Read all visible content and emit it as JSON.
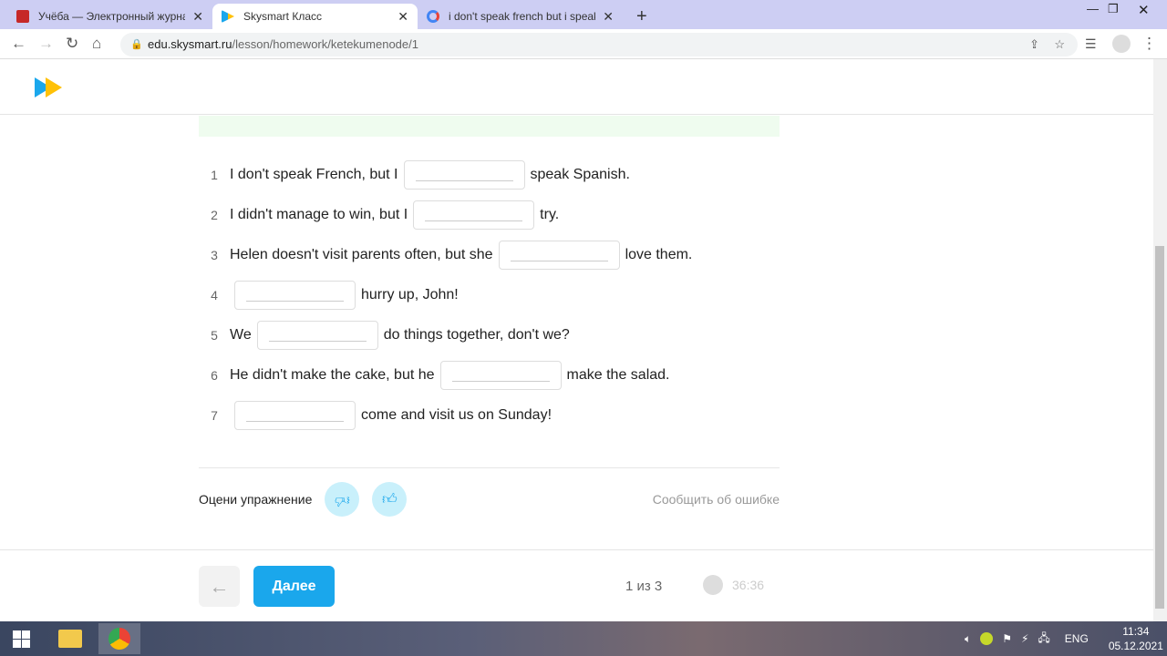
{
  "browser": {
    "tabs": [
      {
        "label": "Учёба — Электронный журнал",
        "favicon": "diary-icon",
        "color": "#c62828"
      },
      {
        "label": "Skysmart Класс",
        "favicon": "skysmart-icon",
        "active": true
      },
      {
        "label": "i don't speak french but i speak s",
        "favicon": "google-icon"
      }
    ],
    "new_tab": "+",
    "url_host": "edu.skysmart.ru",
    "url_path": "/lesson/homework/ketekumenode/1"
  },
  "exercise": {
    "rows": [
      {
        "n": "1",
        "before": "I don't speak French, but I",
        "after": "speak Spanish."
      },
      {
        "n": "2",
        "before": "I didn't manage to win, but I",
        "after": "try."
      },
      {
        "n": "3",
        "before": "Helen doesn't visit parents often, but she",
        "after": "love them."
      },
      {
        "n": "4",
        "before": "",
        "after": "hurry up, John!"
      },
      {
        "n": "5",
        "before": "We",
        "after": "do things together, don't we?"
      },
      {
        "n": "6",
        "before": "He didn't make the cake, but he",
        "after": "make the salad."
      },
      {
        "n": "7",
        "before": "",
        "after": "come and visit us on Sunday!"
      }
    ]
  },
  "rating": {
    "label": "Оцени упражнение",
    "report": "Сообщить об ошибке"
  },
  "footer": {
    "next": "Далее",
    "counter": "1 из 3",
    "timer": "36:36"
  },
  "colors": {
    "accent": "#1aa7ec",
    "rate_bg": "#c9f0fb",
    "green_strip": "#effcef"
  },
  "taskbar": {
    "lang": "ENG",
    "time": "11:34",
    "date": "05.12.2021"
  }
}
